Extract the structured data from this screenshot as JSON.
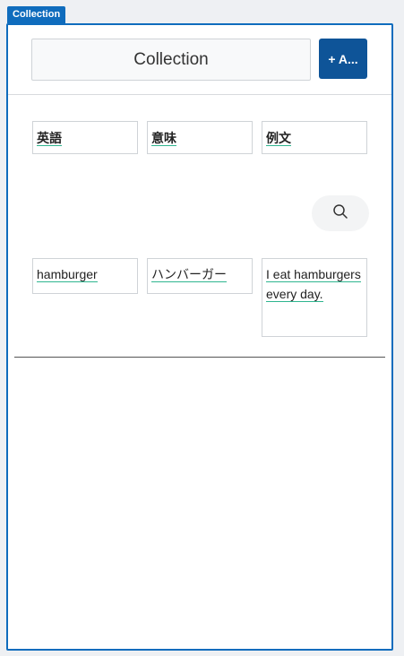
{
  "tab": {
    "label": "Collection"
  },
  "header": {
    "title": "Collection",
    "add_button_label": "+ A..."
  },
  "columns": [
    "英語",
    "意味",
    "例文"
  ],
  "rows": [
    {
      "english": "hamburger",
      "meaning": "ハンバーガー",
      "example": "I eat hamburgers every day."
    }
  ],
  "icons": {
    "search": "search-icon"
  },
  "colors": {
    "accent": "#0f6cbd",
    "button": "#0e5498",
    "underline": "#2fb58f"
  }
}
